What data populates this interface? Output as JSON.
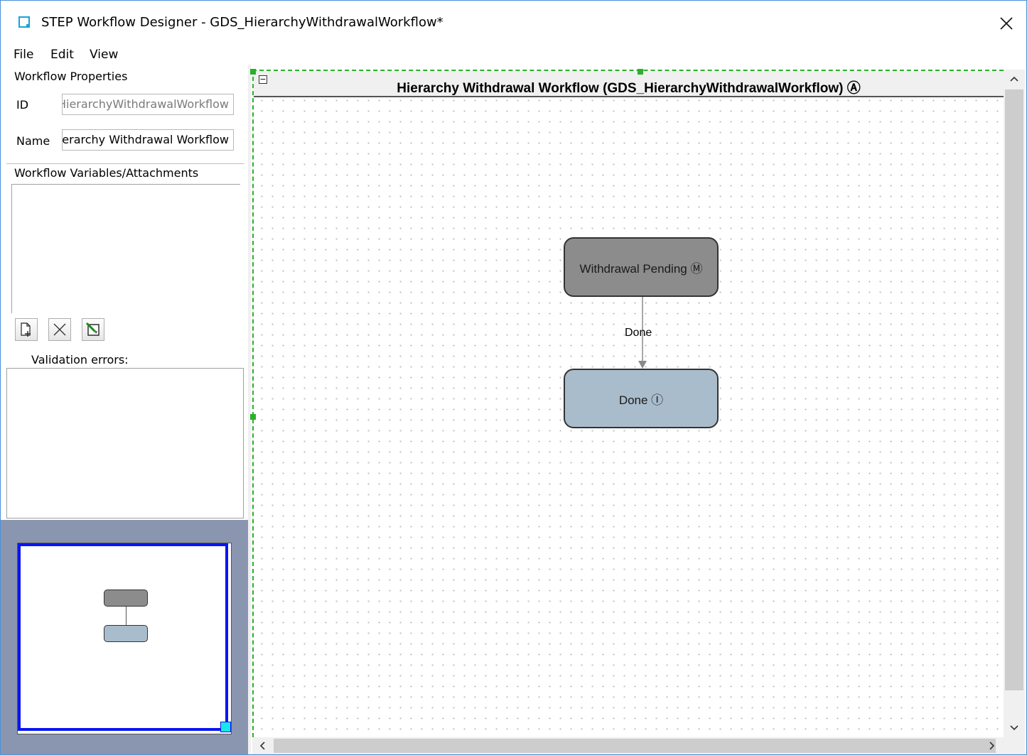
{
  "window": {
    "title": "STEP Workflow Designer - GDS_HierarchyWithdrawalWorkflow*"
  },
  "menu": [
    "File",
    "Edit",
    "View"
  ],
  "properties": {
    "heading": "Workflow Properties",
    "id_label": "ID",
    "id_value": "GDS_HierarchyWithdrawalWorkflow",
    "name_label": "Name",
    "name_value": "Hierarchy Withdrawal Workflow"
  },
  "variables": {
    "heading": "Workflow Variables/Attachments",
    "buttons": [
      "add-icon",
      "delete-icon",
      "edit-icon"
    ]
  },
  "validation": {
    "heading": "Validation errors:"
  },
  "canvas": {
    "title": "Hierarchy Withdrawal Workflow (GDS_HierarchyWithdrawalWorkflow) Ⓐ",
    "states": [
      {
        "label": "Withdrawal Pending Ⓜ",
        "color": "#8c8c8c"
      },
      {
        "label": "Done Ⓘ",
        "color": "#a9bccc"
      }
    ],
    "transition_label": "Done"
  },
  "colors": {
    "selection_dashed": "#2ab02a",
    "overview_viewport": "#0a16f0",
    "overview_bg": "#8a96b0"
  }
}
